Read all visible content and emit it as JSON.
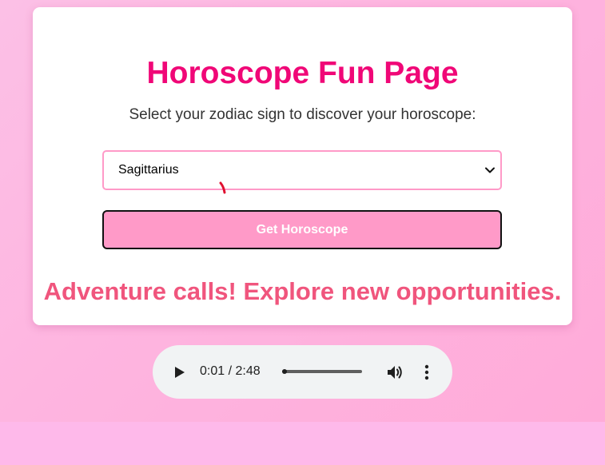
{
  "page": {
    "title": "Horoscope Fun Page",
    "prompt": "Select your zodiac sign to discover your horoscope:"
  },
  "zodiac_select": {
    "selected": "Sagittarius",
    "icon": "chevron-down-icon"
  },
  "button": {
    "label": "Get Horoscope"
  },
  "horoscope": {
    "text": "Adventure calls! Explore new opportunities."
  },
  "audio_player": {
    "time_display": "0:01 / 2:48",
    "current_time": "0:01",
    "duration": "2:48",
    "progress_fraction": 0.006,
    "icons": [
      "play-icon",
      "volume-icon",
      "more-options-icon"
    ]
  },
  "colors": {
    "title": "#f00777",
    "result": "#f0557d",
    "accent": "#ff9ac8",
    "background": "#ffb5e0"
  }
}
